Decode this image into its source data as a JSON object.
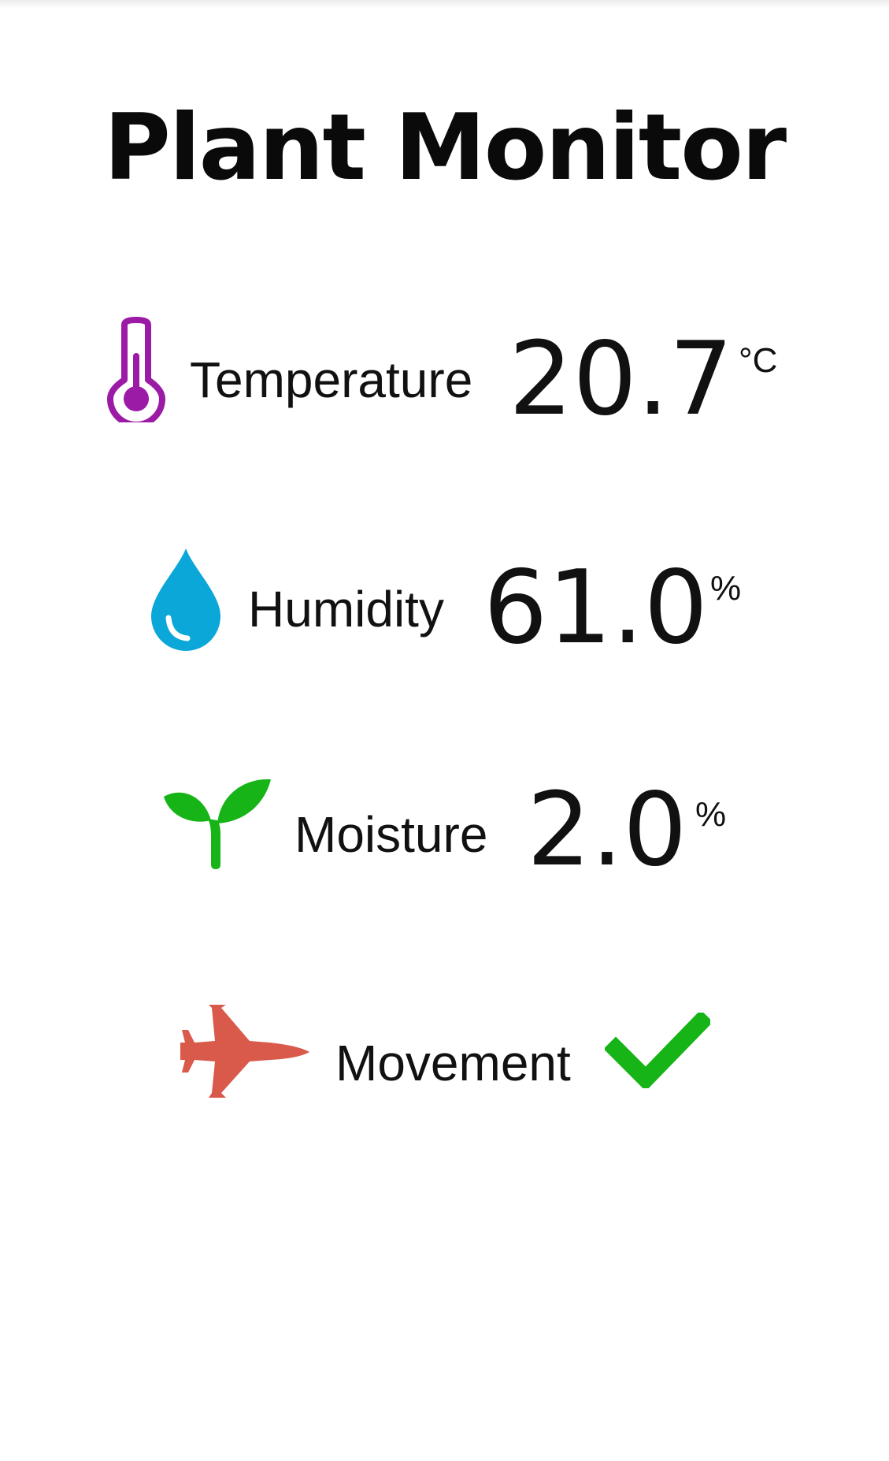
{
  "app": {
    "title": "Plant Monitor"
  },
  "colors": {
    "temperature_icon": "#9b1aa6",
    "humidity_icon": "#0aa7d8",
    "moisture_icon": "#16b416",
    "movement_icon": "#d9594a",
    "movement_status": "#16b416"
  },
  "readings": {
    "temperature": {
      "icon": "thermometer-icon",
      "label": "Temperature",
      "value": "20.7",
      "unit": "°C"
    },
    "humidity": {
      "icon": "water-drop-icon",
      "label": "Humidity",
      "value": "61.0",
      "unit": "%"
    },
    "moisture": {
      "icon": "sprout-icon",
      "label": "Moisture",
      "value": "2.0",
      "unit": "%"
    },
    "movement": {
      "icon": "jet-icon",
      "label": "Movement",
      "status_icon": "checkmark-icon"
    }
  }
}
